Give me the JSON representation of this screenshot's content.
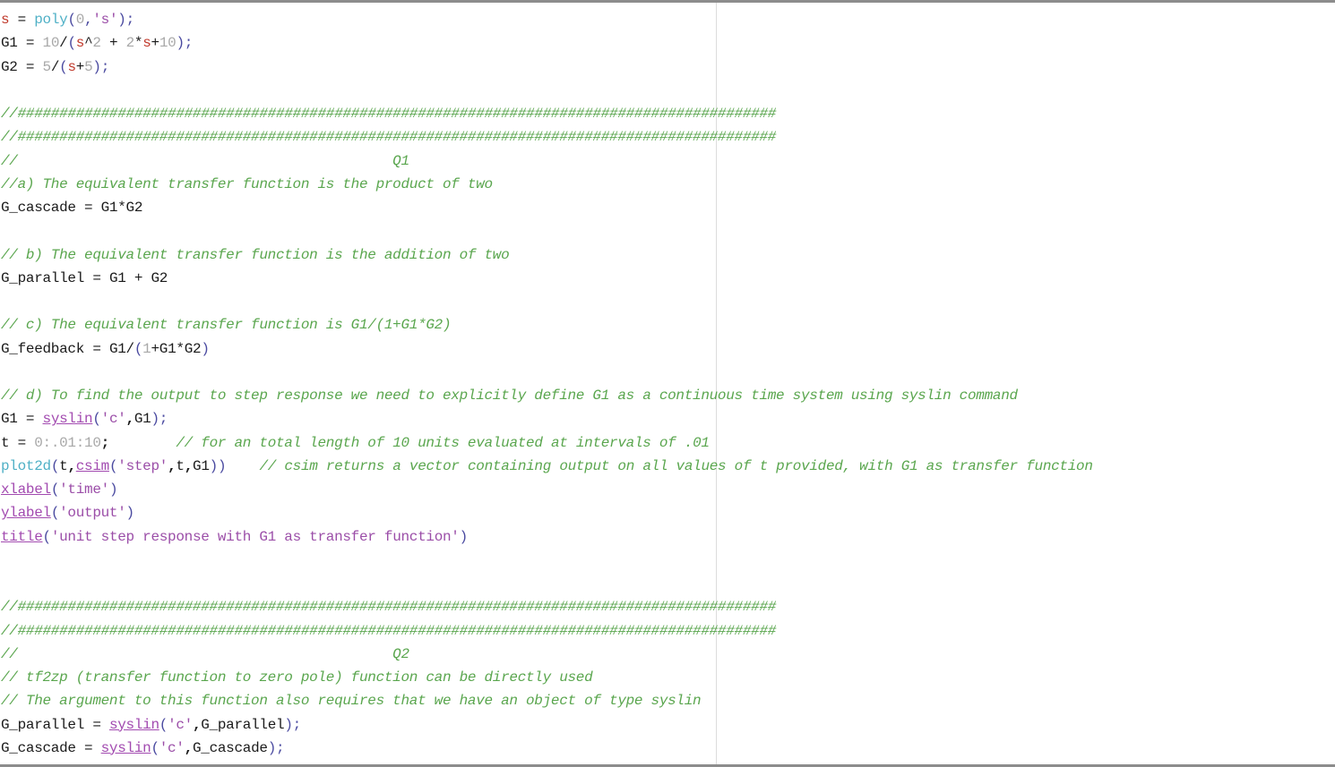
{
  "editor": {
    "lines": [
      [
        {
          "t": "s",
          "c": "r"
        },
        {
          "t": " = ",
          "c": "k"
        },
        {
          "t": "poly",
          "c": "f"
        },
        {
          "t": "(",
          "c": "p"
        },
        {
          "t": "0",
          "c": "n"
        },
        {
          "t": ",",
          "c": "p"
        },
        {
          "t": "'s'",
          "c": "s"
        },
        {
          "t": ");",
          "c": "p"
        }
      ],
      [
        {
          "t": "G1",
          "c": "k"
        },
        {
          "t": " = ",
          "c": "k"
        },
        {
          "t": "10",
          "c": "n"
        },
        {
          "t": "/",
          "c": "k"
        },
        {
          "t": "(",
          "c": "p"
        },
        {
          "t": "s",
          "c": "r"
        },
        {
          "t": "^",
          "c": "k"
        },
        {
          "t": "2",
          "c": "n"
        },
        {
          "t": " + ",
          "c": "k"
        },
        {
          "t": "2",
          "c": "n"
        },
        {
          "t": "*",
          "c": "k"
        },
        {
          "t": "s",
          "c": "r"
        },
        {
          "t": "+",
          "c": "k"
        },
        {
          "t": "10",
          "c": "n"
        },
        {
          "t": ");",
          "c": "p"
        }
      ],
      [
        {
          "t": "G2",
          "c": "k"
        },
        {
          "t": " = ",
          "c": "k"
        },
        {
          "t": "5",
          "c": "n"
        },
        {
          "t": "/",
          "c": "k"
        },
        {
          "t": "(",
          "c": "p"
        },
        {
          "t": "s",
          "c": "r"
        },
        {
          "t": "+",
          "c": "k"
        },
        {
          "t": "5",
          "c": "n"
        },
        {
          "t": ");",
          "c": "p"
        }
      ],
      [],
      [
        {
          "t": "//###########################################################################################",
          "c": "c"
        }
      ],
      [
        {
          "t": "//###########################################################################################",
          "c": "c"
        }
      ],
      [
        {
          "t": "//                                             Q1",
          "c": "c"
        }
      ],
      [
        {
          "t": "//a) The equivalent transfer function is the product of two",
          "c": "c"
        }
      ],
      [
        {
          "t": "G_cascade",
          "c": "k"
        },
        {
          "t": " = ",
          "c": "k"
        },
        {
          "t": "G1",
          "c": "k"
        },
        {
          "t": "*",
          "c": "k"
        },
        {
          "t": "G2",
          "c": "k"
        }
      ],
      [],
      [
        {
          "t": "// b) The equivalent transfer function is the addition of two",
          "c": "c"
        }
      ],
      [
        {
          "t": "G_parallel",
          "c": "k"
        },
        {
          "t": " = ",
          "c": "k"
        },
        {
          "t": "G1",
          "c": "k"
        },
        {
          "t": " + ",
          "c": "k"
        },
        {
          "t": "G2",
          "c": "k"
        }
      ],
      [],
      [
        {
          "t": "// c) The equivalent transfer function is G1/(1+G1*G2) ",
          "c": "c"
        }
      ],
      [
        {
          "t": "G_feedback",
          "c": "k"
        },
        {
          "t": " = ",
          "c": "k"
        },
        {
          "t": "G1",
          "c": "k"
        },
        {
          "t": "/",
          "c": "k"
        },
        {
          "t": "(",
          "c": "p"
        },
        {
          "t": "1",
          "c": "n"
        },
        {
          "t": "+",
          "c": "k"
        },
        {
          "t": "G1",
          "c": "k"
        },
        {
          "t": "*",
          "c": "k"
        },
        {
          "t": "G2",
          "c": "k"
        },
        {
          "t": ")",
          "c": "p"
        }
      ],
      [],
      [
        {
          "t": "// d) To find the output to step response we need to explicitly define G1 as a continuous time system using syslin command",
          "c": "c"
        }
      ],
      [
        {
          "t": "G1",
          "c": "k"
        },
        {
          "t": " = ",
          "c": "k"
        },
        {
          "t": "syslin",
          "c": "l"
        },
        {
          "t": "(",
          "c": "p"
        },
        {
          "t": "'c'",
          "c": "s"
        },
        {
          "t": ",",
          "c": "b"
        },
        {
          "t": "G1",
          "c": "k"
        },
        {
          "t": ");",
          "c": "p"
        }
      ],
      [
        {
          "t": "t",
          "c": "k"
        },
        {
          "t": " = ",
          "c": "k"
        },
        {
          "t": "0:.01:10",
          "c": "n"
        },
        {
          "t": ";",
          "c": "b"
        },
        {
          "t": "        ",
          "c": "k"
        },
        {
          "t": "// for an total length of 10 units evaluated at intervals of .01",
          "c": "c"
        }
      ],
      [
        {
          "t": "plot2d",
          "c": "f"
        },
        {
          "t": "(",
          "c": "p"
        },
        {
          "t": "t",
          "c": "k"
        },
        {
          "t": ",",
          "c": "b"
        },
        {
          "t": "csim",
          "c": "l"
        },
        {
          "t": "(",
          "c": "p"
        },
        {
          "t": "'step'",
          "c": "s"
        },
        {
          "t": ",",
          "c": "b"
        },
        {
          "t": "t",
          "c": "k"
        },
        {
          "t": ",",
          "c": "b"
        },
        {
          "t": "G1",
          "c": "k"
        },
        {
          "t": "))",
          "c": "p"
        },
        {
          "t": "    ",
          "c": "k"
        },
        {
          "t": "// csim returns a vector containing output on all values of t provided, with G1 as transfer function",
          "c": "c"
        }
      ],
      [
        {
          "t": "xlabel",
          "c": "l"
        },
        {
          "t": "(",
          "c": "p"
        },
        {
          "t": "'time'",
          "c": "s"
        },
        {
          "t": ")",
          "c": "p"
        }
      ],
      [
        {
          "t": "ylabel",
          "c": "l"
        },
        {
          "t": "(",
          "c": "p"
        },
        {
          "t": "'output'",
          "c": "s"
        },
        {
          "t": ")",
          "c": "p"
        }
      ],
      [
        {
          "t": "title",
          "c": "l"
        },
        {
          "t": "(",
          "c": "p"
        },
        {
          "t": "'unit step response with G1 as transfer function'",
          "c": "s"
        },
        {
          "t": ")",
          "c": "p"
        }
      ],
      [],
      [],
      [
        {
          "t": "//###########################################################################################",
          "c": "c"
        }
      ],
      [
        {
          "t": "//###########################################################################################",
          "c": "c"
        }
      ],
      [
        {
          "t": "//                                             Q2",
          "c": "c"
        }
      ],
      [
        {
          "t": "// tf2zp (transfer function to zero pole) function can be directly used",
          "c": "c"
        }
      ],
      [
        {
          "t": "// The argument to this function also requires that we have an object of type syslin",
          "c": "c"
        }
      ],
      [
        {
          "t": "G_parallel",
          "c": "k"
        },
        {
          "t": " = ",
          "c": "k"
        },
        {
          "t": "syslin",
          "c": "l"
        },
        {
          "t": "(",
          "c": "p"
        },
        {
          "t": "'c'",
          "c": "s"
        },
        {
          "t": ",",
          "c": "b"
        },
        {
          "t": "G_parallel",
          "c": "k"
        },
        {
          "t": ");",
          "c": "p"
        }
      ],
      [
        {
          "t": "G_cascade",
          "c": "k"
        },
        {
          "t": " = ",
          "c": "k"
        },
        {
          "t": "syslin",
          "c": "l"
        },
        {
          "t": "(",
          "c": "p"
        },
        {
          "t": "'c'",
          "c": "s"
        },
        {
          "t": ",",
          "c": "b"
        },
        {
          "t": "G_cascade",
          "c": "k"
        },
        {
          "t": ");",
          "c": "p"
        }
      ]
    ]
  }
}
